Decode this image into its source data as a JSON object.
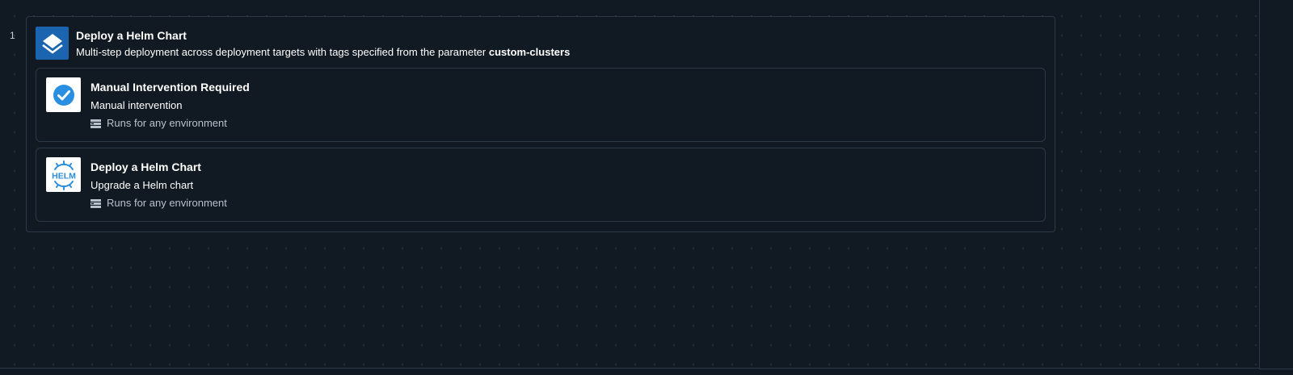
{
  "process": {
    "step_number": "1",
    "step": {
      "title": "Deploy a Helm Chart",
      "description_prefix": "Multi-step deployment across deployment targets with tags specified from the parameter",
      "description_param": "custom-clusters",
      "icon": "layers-icon",
      "children": [
        {
          "title": "Manual Intervention Required",
          "description": "Manual intervention",
          "environment": "Runs for any environment",
          "icon": "check-circle-icon"
        },
        {
          "title": "Deploy a Helm Chart",
          "description": "Upgrade a Helm chart",
          "environment": "Runs for any environment",
          "icon": "helm-icon",
          "icon_text": "HELM"
        }
      ]
    }
  },
  "colors": {
    "background": "#111922",
    "card_border": "#2c3a48",
    "accent_blue": "#1a64b0",
    "check_blue": "#2a8fe0",
    "helm_blue": "#2b8ed8"
  }
}
